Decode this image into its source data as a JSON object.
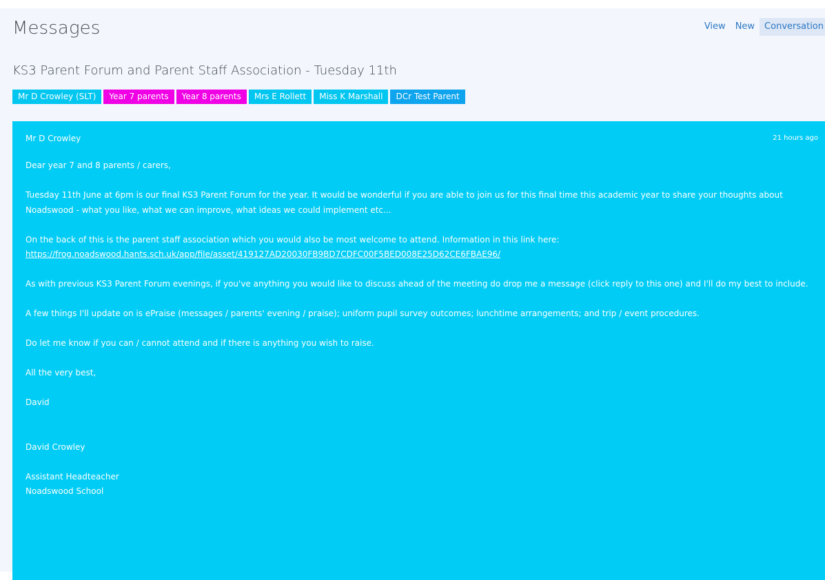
{
  "header": {
    "title": "Messages",
    "nav": {
      "view": "View",
      "new": "New",
      "conversation": "Conversation"
    }
  },
  "thread": {
    "subject": "KS3 Parent Forum and Parent Staff Association - Tuesday 11th",
    "recipients": [
      {
        "label": "Mr D Crowley (SLT)",
        "color": "#00c6f0"
      },
      {
        "label": "Year 7 parents",
        "color": "#f000e4"
      },
      {
        "label": "Year 8 parents",
        "color": "#f000e4"
      },
      {
        "label": "Mrs E Rollett",
        "color": "#00c6f0"
      },
      {
        "label": "Miss K Marshall",
        "color": "#00c6f0"
      },
      {
        "label": "DCr Test Parent",
        "color": "#0ea4ee"
      }
    ]
  },
  "message": {
    "sender": "Mr D Crowley",
    "time": "21 hours ago",
    "background": "#00ccf5",
    "greeting": "Dear year 7 and 8 parents / carers,",
    "para1": "Tuesday 11th June at 6pm is our final KS3 Parent Forum for the year. It would be wonderful if you are able to join us for this final time this academic year to share your thoughts about Noadswood - what you like, what we can improve, what ideas we could implement etc...",
    "para2": "On the back of this is the parent staff association which you would also be most welcome to attend. Information in this link here:",
    "link": "https://frog.noadswood.hants.sch.uk/app/file/asset/419127AD20030FB9BD7CDFC00F5BED008E25D62CE6FBAE96/",
    "para3": "As with previous KS3 Parent Forum evenings, if you've anything you would like to discuss ahead of the meeting do drop me a message (click reply to this one) and I'll do my best to include.",
    "para4": "A few things I'll update on is ePraise (messages / parents' evening / praise); uniform pupil survey outcomes; lunchtime arrangements; and trip / event procedures.",
    "para5": "Do let me know if you can / cannot attend and if there is anything you wish to raise.",
    "signoff": "All the very best,",
    "name_short": "David",
    "name_full": "David Crowley",
    "role": "Assistant Headteacher",
    "school": "Noadswood School"
  }
}
